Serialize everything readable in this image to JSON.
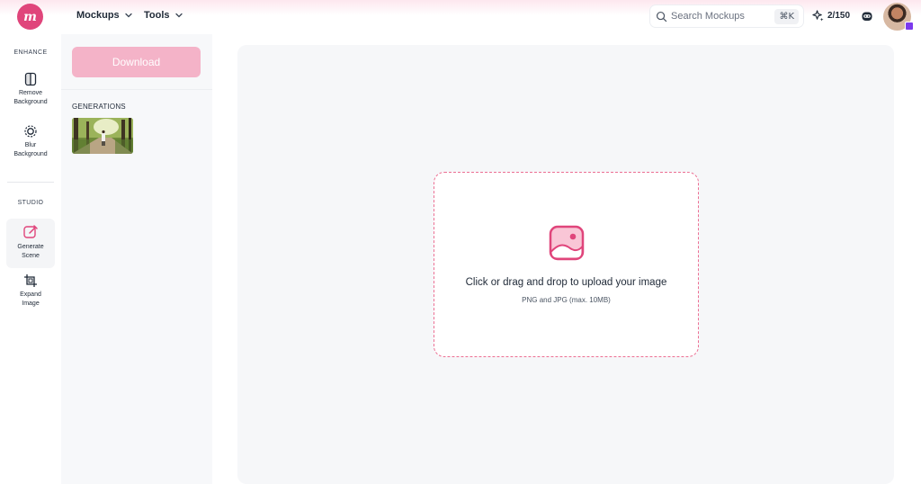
{
  "header": {
    "logo_text": "m",
    "nav": [
      {
        "label": "Mockups"
      },
      {
        "label": "Tools"
      }
    ],
    "search": {
      "placeholder": "Search Mockups",
      "shortcut": "⌘K"
    },
    "credits": "2/150"
  },
  "rail": {
    "sections": {
      "enhance": "ENHANCE",
      "studio": "STUDIO"
    },
    "items": [
      {
        "label_line1": "Remove",
        "label_line2": "Background",
        "icon": "split-square-icon"
      },
      {
        "label_line1": "Blur",
        "label_line2": "Background",
        "icon": "blur-circle-icon"
      },
      {
        "label_line1": "Generate",
        "label_line2": "Scene",
        "icon": "edit-square-icon",
        "active": true
      },
      {
        "label_line1": "Expand",
        "label_line2": "Image",
        "icon": "crop-expand-icon"
      }
    ]
  },
  "panel": {
    "download_label": "Download",
    "generations_title": "GENERATIONS"
  },
  "upload": {
    "title": "Click or drag and drop to upload your image",
    "subtitle": "PNG and JPG (max. 10MB)"
  },
  "colors": {
    "accent": "#e0457b",
    "dropzone_border": "#ec6f93",
    "download_bg": "#f4b3c8"
  }
}
